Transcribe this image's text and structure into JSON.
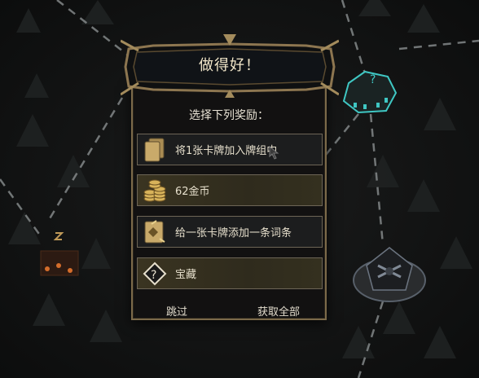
{
  "dialog": {
    "title": "做得好！",
    "subtitle": "选择下列奖励：",
    "rewards": [
      {
        "label": "将1张卡牌加入牌组中",
        "icon": "card-icon"
      },
      {
        "label": "62金币",
        "icon": "gold-coins-icon"
      },
      {
        "label": "给一张卡牌添加一条词条",
        "icon": "card-upgrade-icon"
      },
      {
        "label": "宝藏",
        "icon": "treasure-question-icon"
      }
    ],
    "skip_label": "跳过",
    "take_all_label": "获取全部"
  },
  "map": {
    "mystery_node_icon": "question-mark-icon",
    "boss_node_icon": "boss-lair-icon",
    "left_node_icon": "camp-icon"
  },
  "colors": {
    "gold_border": "#7c6a4a",
    "text_light": "#f1e6c9",
    "highlight_cyan": "#3fc7c3",
    "panel_bg": "#121111"
  }
}
